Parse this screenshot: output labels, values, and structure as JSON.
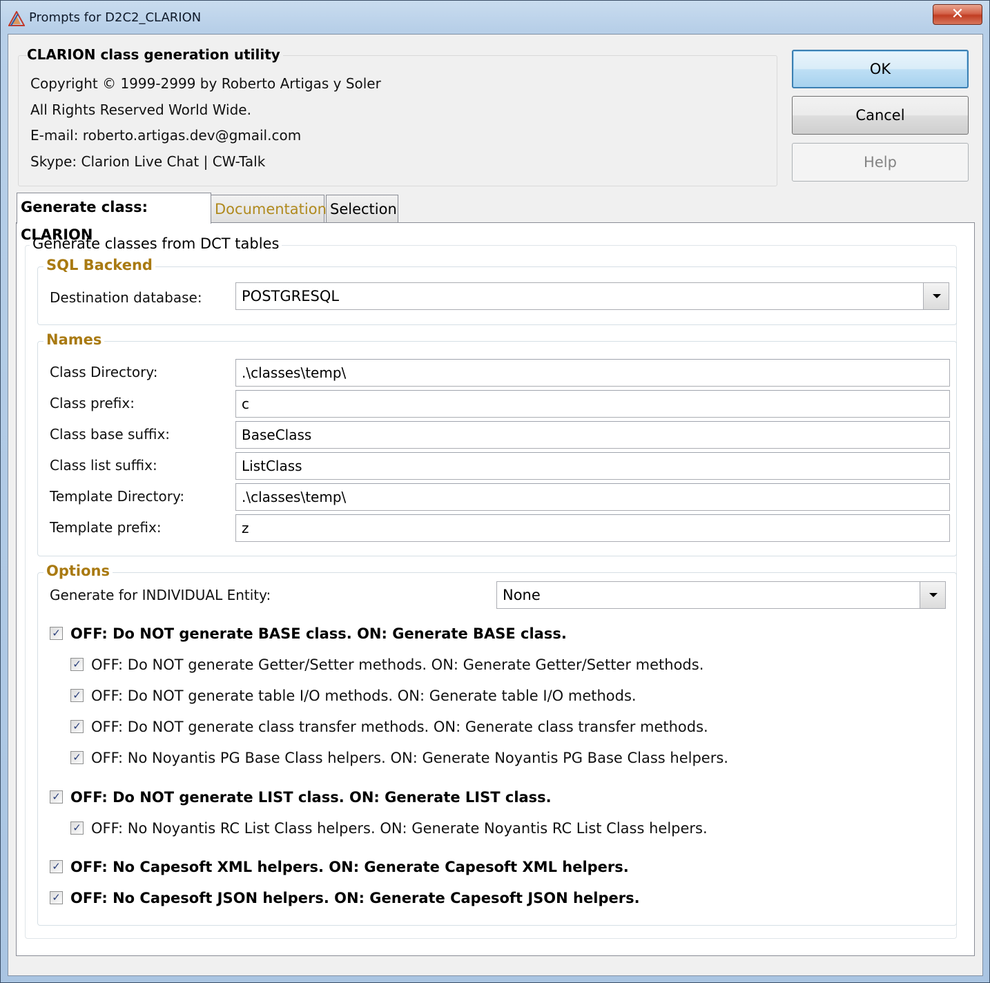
{
  "window": {
    "title": "Prompts for D2C2_CLARION",
    "close_glyph": "✕"
  },
  "header": {
    "title": "CLARION class generation utility",
    "lines": [
      "Copyright © 1999-2999 by Roberto Artigas y Soler",
      "All Rights Reserved World Wide.",
      "E-mail: roberto.artigas.dev@gmail.com",
      "Skype: Clarion Live Chat | CW-Talk"
    ]
  },
  "buttons": {
    "ok": "OK",
    "cancel": "Cancel",
    "help": "Help"
  },
  "tabs": [
    {
      "label": "Generate class: CLARION",
      "active": true
    },
    {
      "label": "Documentation",
      "color": "#b08a1e"
    },
    {
      "label": "Selection"
    }
  ],
  "main_group": {
    "title": "Generate classes from DCT tables"
  },
  "sql_backend": {
    "title": "SQL Backend",
    "destination_label": "Destination database:",
    "destination_value": "POSTGRESQL"
  },
  "names": {
    "title": "Names",
    "fields": [
      {
        "label": "Class Directory:",
        "value": ".\\classes\\temp\\"
      },
      {
        "label": "Class prefix:",
        "value": "c"
      },
      {
        "label": "Class base suffix:",
        "value": "BaseClass"
      },
      {
        "label": "Class list suffix:",
        "value": "ListClass"
      },
      {
        "label": "Template Directory:",
        "value": ".\\classes\\temp\\"
      },
      {
        "label": "Template prefix:",
        "value": "z"
      }
    ]
  },
  "options": {
    "title": "Options",
    "entity_label": "Generate for INDIVIDUAL Entity:",
    "entity_value": "None",
    "check_glyph": "✓",
    "checks": [
      {
        "label": "OFF: Do NOT generate BASE class. ON: Generate BASE class.",
        "checked": true,
        "bold": true
      },
      {
        "label": "OFF: Do NOT generate Getter/Setter methods. ON: Generate Getter/Setter methods.",
        "checked": true
      },
      {
        "label": "OFF: Do NOT generate table I/O methods. ON: Generate table I/O methods.",
        "checked": true
      },
      {
        "label": "OFF: Do NOT generate class transfer methods. ON: Generate class transfer methods.",
        "checked": true
      },
      {
        "label": "OFF: No Noyantis PG Base Class helpers. ON: Generate Noyantis PG Base Class helpers.",
        "checked": true
      },
      {
        "label": "OFF: Do NOT generate LIST class. ON: Generate LIST class.",
        "checked": true,
        "bold": true
      },
      {
        "label": "OFF: No Noyantis RC List Class helpers. ON: Generate Noyantis RC List Class helpers.",
        "checked": true
      },
      {
        "label": "OFF: No Capesoft XML helpers. ON: Generate Capesoft XML helpers.",
        "checked": true,
        "bold": true
      },
      {
        "label": "OFF: No Capesoft JSON helpers. ON: Generate Capesoft JSON helpers.",
        "checked": true,
        "bold": true
      }
    ]
  }
}
